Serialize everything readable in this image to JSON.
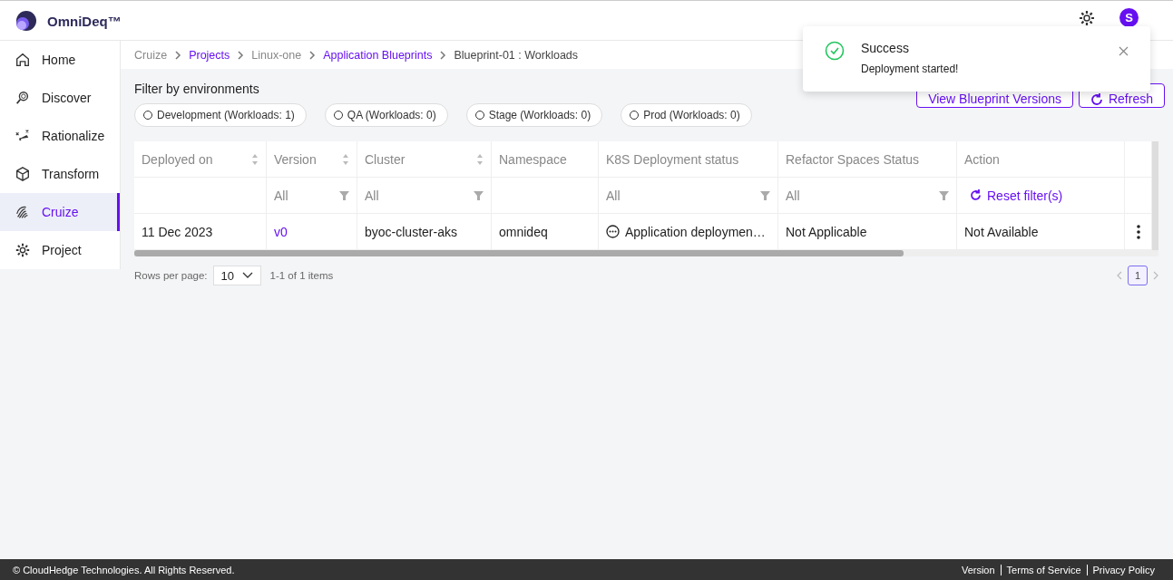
{
  "app": {
    "name": "OmniDeq™",
    "avatar": "S"
  },
  "sidebar": {
    "items": [
      {
        "label": "Home",
        "selected": false
      },
      {
        "label": "Discover",
        "selected": false
      },
      {
        "label": "Rationalize",
        "selected": false
      },
      {
        "label": "Transform",
        "selected": false
      },
      {
        "label": "Cruize",
        "selected": true
      },
      {
        "label": "Project",
        "selected": false
      }
    ]
  },
  "breadcrumb": [
    {
      "label": "Cruize",
      "link": false
    },
    {
      "label": "Projects",
      "link": true
    },
    {
      "label": "Linux-one",
      "link": false
    },
    {
      "label": "Application Blueprints",
      "link": true
    },
    {
      "label": "Blueprint-01 : Workloads",
      "link": false
    }
  ],
  "filter": {
    "title": "Filter by environments",
    "environments": [
      {
        "label": "Development (Workloads: 1)",
        "selected": false
      },
      {
        "label": "QA (Workloads: 0)",
        "selected": false
      },
      {
        "label": "Stage (Workloads: 0)",
        "selected": false
      },
      {
        "label": "Prod (Workloads: 0)",
        "selected": false
      }
    ]
  },
  "buttons": [
    {
      "label": "View Blueprint Versions"
    },
    {
      "label": "Refresh"
    }
  ],
  "table": {
    "columns": [
      {
        "label": "Deployed on",
        "sortable": true
      },
      {
        "label": "Version",
        "sortable": true,
        "filter": "All"
      },
      {
        "label": "Cluster",
        "sortable": true,
        "filter": "All"
      },
      {
        "label": "Namespace",
        "sortable": false
      },
      {
        "label": "K8S Deployment status",
        "sortable": false,
        "filter": "All"
      },
      {
        "label": "Refactor Spaces Status",
        "sortable": false,
        "filter": "All"
      },
      {
        "label": "Action",
        "sortable": false,
        "reset": "Reset filter(s)"
      }
    ],
    "rows": [
      {
        "cells": [
          {
            "kind": "text",
            "text": "11 Dec 2023"
          },
          {
            "kind": "link",
            "text": "v0"
          },
          {
            "kind": "text",
            "text": "byoc-cluster-aks"
          },
          {
            "kind": "text",
            "text": "omnideq"
          },
          {
            "kind": "status",
            "text": "Application deploymen…"
          },
          {
            "kind": "text",
            "text": "Not Applicable"
          },
          {
            "kind": "text",
            "text": "Not Available"
          }
        ]
      }
    ]
  },
  "pagination": {
    "rows_label": "Rows per page:",
    "page_size": "10",
    "range": "1-1 of 1 items",
    "pages": [
      {
        "label": "1",
        "selected": true
      }
    ]
  },
  "toast": {
    "title": "Success",
    "message": "Deployment started!"
  },
  "footer": {
    "copyright": "© CloudHedge Technologies. All Rights Reserved.",
    "links": [
      "Version",
      "Terms of Service",
      "Privacy Policy"
    ]
  }
}
